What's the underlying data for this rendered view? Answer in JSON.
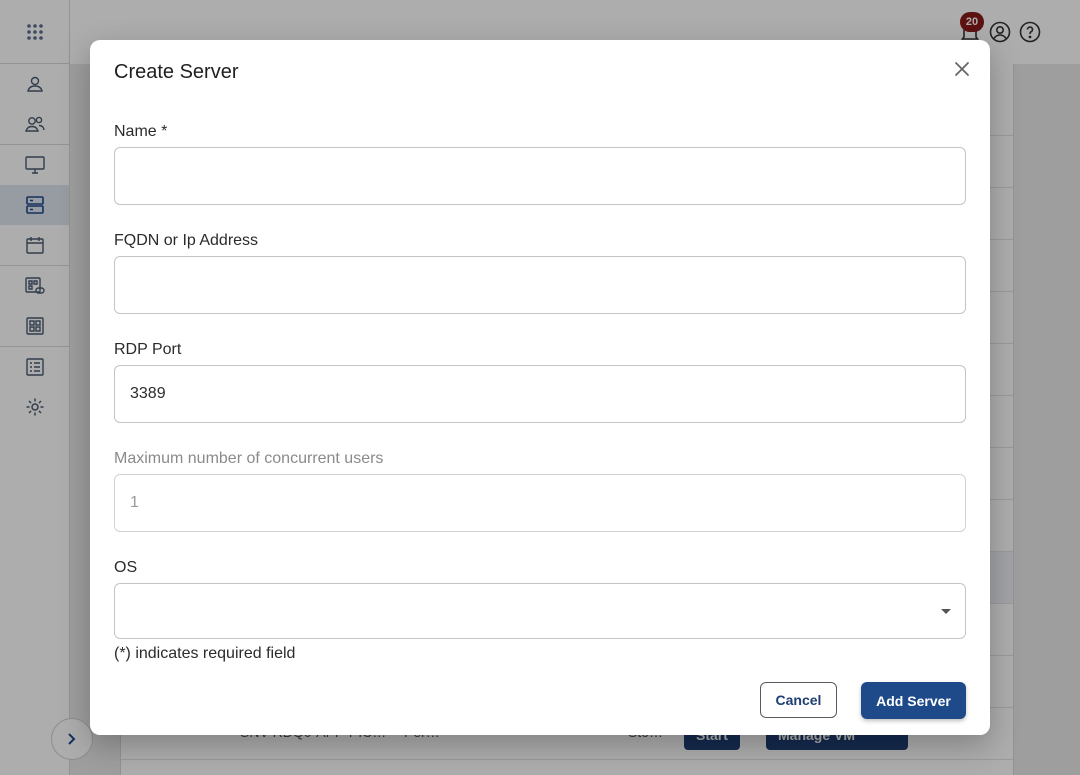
{
  "topbar": {
    "notification_count": "20"
  },
  "background_table": {
    "partial_row_text": [
      "SNV-RDQ0-APP-PIC…",
      "Per…",
      "Sto…"
    ],
    "start_button": "Start",
    "manage_button": "Manage VM"
  },
  "modal": {
    "title": "Create Server",
    "fields": {
      "name": {
        "label": "Name *",
        "value": ""
      },
      "address": {
        "label": "FQDN or Ip Address",
        "value": ""
      },
      "rdp_port": {
        "label": "RDP Port",
        "value": "3389"
      },
      "max_users": {
        "label": "Maximum number of concurrent users",
        "value": "1"
      },
      "os": {
        "label": "OS",
        "value": ""
      }
    },
    "required_note": "(*) indicates required field",
    "buttons": {
      "cancel": "Cancel",
      "add": "Add Server"
    }
  },
  "colors": {
    "primary": "#1f4a8a",
    "badge": "#8a1b1b",
    "overlay": "rgba(0,0,0,0.32)"
  },
  "icons": {
    "sidebar": [
      "apps-grid-icon",
      "user-icon",
      "users-icon",
      "monitor-icon",
      "server-icon",
      "calendar-icon",
      "app-link-icon",
      "dashboard-icon",
      "list-icon",
      "settings-icon"
    ],
    "topbar": [
      "bell-icon",
      "account-icon",
      "help-icon"
    ],
    "modal": [
      "close-icon",
      "chevron-down-icon"
    ]
  }
}
